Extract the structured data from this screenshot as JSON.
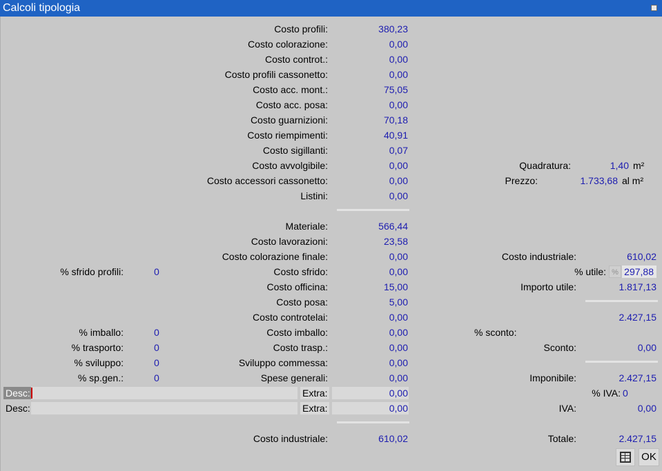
{
  "window": {
    "title": "Calcoli tipologia"
  },
  "costs": [
    {
      "label": "Costo profili:",
      "value": "380,23"
    },
    {
      "label": "Costo colorazione:",
      "value": "0,00"
    },
    {
      "label": "Costo controt.:",
      "value": "0,00"
    },
    {
      "label": "Costo profili cassonetto:",
      "value": "0,00"
    },
    {
      "label": "Costo acc. mont.:",
      "value": "75,05"
    },
    {
      "label": "Costo acc. posa:",
      "value": "0,00"
    },
    {
      "label": "Costo guarnizioni:",
      "value": "70,18"
    },
    {
      "label": "Costo riempimenti:",
      "value": "40,91"
    },
    {
      "label": "Costo sigillanti:",
      "value": "0,07"
    },
    {
      "label": "Costo avvolgibile:",
      "value": "0,00"
    },
    {
      "label": "Costo accessori cassonetto:",
      "value": "0,00"
    },
    {
      "label": "Listini:",
      "value": "0,00"
    }
  ],
  "right_top": {
    "quadratura": {
      "label": "Quadratura:",
      "value": "1,40",
      "unit": "m²"
    },
    "prezzo": {
      "label": "Prezzo:",
      "value": "1.733,68",
      "unit": "al m²"
    }
  },
  "totals": [
    {
      "label": "Materiale:",
      "value": "566,44"
    },
    {
      "label": "Costo lavorazioni:",
      "value": "23,58"
    },
    {
      "label": "Costo colorazione finale:",
      "value": "0,00"
    },
    {
      "label": "Costo sfrido:",
      "value": "0,00"
    },
    {
      "label": "Costo officina:",
      "value": "15,00"
    },
    {
      "label": "Costo posa:",
      "value": "5,00"
    },
    {
      "label": "Costo controtelai:",
      "value": "0,00"
    },
    {
      "label": "Costo imballo:",
      "value": "0,00"
    },
    {
      "label": "Costo trasp.:",
      "value": "0,00"
    },
    {
      "label": "Sviluppo commessa:",
      "value": "0,00"
    },
    {
      "label": "Spese generali:",
      "value": "0,00"
    }
  ],
  "percents": [
    {
      "label": "% sfrido profili:",
      "value": "0"
    },
    {
      "label": "% imballo:",
      "value": "0"
    },
    {
      "label": "% trasporto:",
      "value": "0"
    },
    {
      "label": "% sviluppo:",
      "value": "0"
    },
    {
      "label": "% sp.gen.:",
      "value": "0"
    }
  ],
  "extra": [
    {
      "desc_label": "Desc:",
      "desc_value": "",
      "extra_label": "Extra:",
      "extra_value": "0,00"
    },
    {
      "desc_label": "Desc:",
      "desc_value": "",
      "extra_label": "Extra:",
      "extra_value": "0,00"
    }
  ],
  "right": {
    "costo_industriale": {
      "label": "Costo industriale:",
      "value": "610,02"
    },
    "utile": {
      "label": "% utile:",
      "button": "%",
      "value": "297,88"
    },
    "importo_utile": {
      "label": "Importo utile:",
      "value": "1.817,13"
    },
    "subtotal": "2.427,15",
    "pct_sconto": {
      "label": "% sconto:"
    },
    "sconto": {
      "label": "Sconto:",
      "value": "0,00"
    },
    "imponibile": {
      "label": "Imponibile:",
      "value": "2.427,15"
    },
    "pct_iva": {
      "label": "% IVA:",
      "value": "0"
    },
    "iva": {
      "label": "IVA:",
      "value": "0,00"
    },
    "totale": {
      "label": "Totale:",
      "value": "2.427,15"
    }
  },
  "footer": {
    "label": "Costo industriale:",
    "value": "610,02"
  },
  "buttons": {
    "ok": "OK",
    "table_icon": "table-icon"
  },
  "colors": {
    "titlebar": "#1f63c4",
    "value_text": "#1d1db0",
    "background": "#c8c8c8"
  }
}
